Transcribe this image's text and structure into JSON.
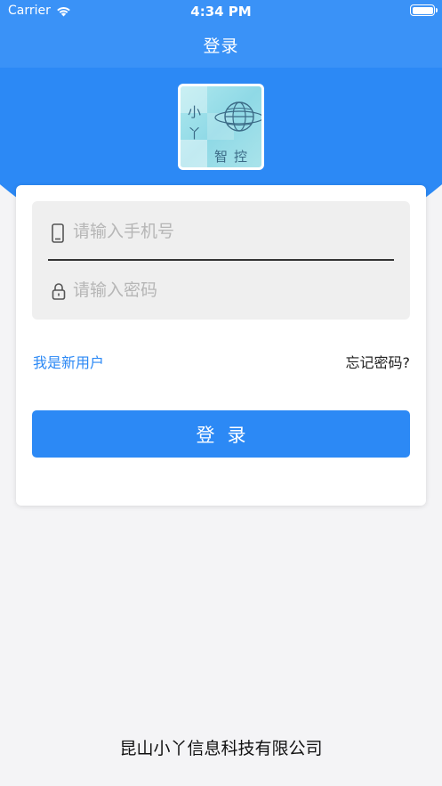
{
  "status_bar": {
    "carrier": "Carrier",
    "time": "4:34 PM"
  },
  "nav": {
    "title": "登录"
  },
  "logo": {
    "chars": [
      "小",
      "丫",
      "智",
      "控"
    ]
  },
  "form": {
    "phone_placeholder": "请输入手机号",
    "phone_value": "",
    "password_placeholder": "请输入密码",
    "password_value": "",
    "new_user_label": "我是新用户",
    "forgot_password_label": "忘记密码?",
    "login_button_label": "登录"
  },
  "footer": {
    "company": "昆山小丫信息科技有限公司"
  },
  "colors": {
    "primary": "#2c89f5",
    "header": "#3a92f7",
    "background": "#f4f4f6"
  }
}
